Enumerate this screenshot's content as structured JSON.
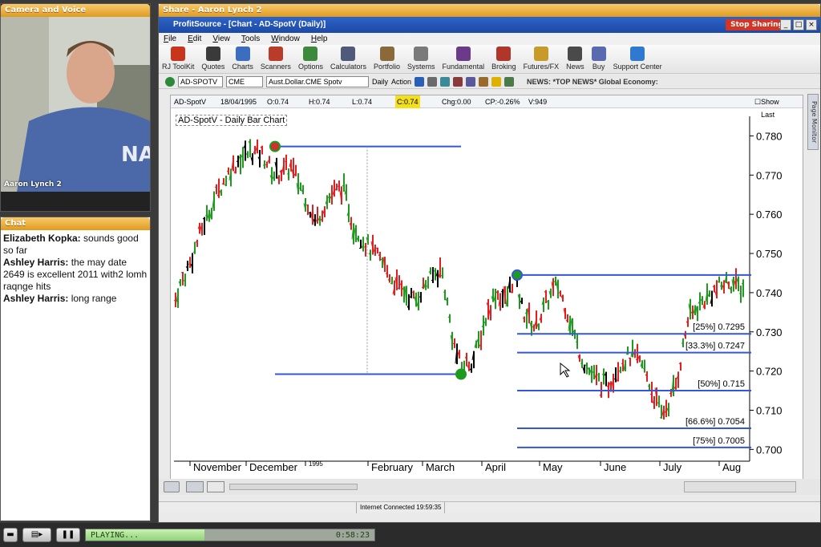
{
  "camera_panel": {
    "title": "Camera and Voice",
    "presenter_name": "Aaron Lynch 2"
  },
  "chat_panel": {
    "title": "Chat",
    "messages": [
      {
        "author": "Elizabeth Kopka:",
        "text": " sounds good so far"
      },
      {
        "author": "Ashley Harris:",
        "text": " the may date 2649 is excellent 2011 with2 lomh raqnge hits"
      },
      {
        "author": "Ashley Harris:",
        "text": " long range"
      }
    ]
  },
  "share_panel": {
    "title": "Share - Aaron Lynch 2",
    "stop_sharing_label": "Stop Sharing"
  },
  "app": {
    "window_title": "ProfitSource - [Chart - AD-SpotV (Daily)]",
    "menu": [
      "File",
      "Edit",
      "View",
      "Tools",
      "Window",
      "Help"
    ],
    "toolbar": [
      {
        "label": "RJ ToolKit",
        "icon": "toolkit-icon",
        "color": "#c8341c"
      },
      {
        "label": "Quotes",
        "icon": "quotes-icon",
        "color": "#3a3a3a"
      },
      {
        "label": "Charts",
        "icon": "charts-icon",
        "color": "#3d6dbf"
      },
      {
        "label": "Scanners",
        "icon": "scanners-icon",
        "color": "#b93b2a"
      },
      {
        "label": "Options",
        "icon": "options-icon",
        "color": "#3d8a3d"
      },
      {
        "label": "Calculators",
        "icon": "calculators-icon",
        "color": "#4f5a7a"
      },
      {
        "label": "Portfolio",
        "icon": "portfolio-icon",
        "color": "#8a6a3a"
      },
      {
        "label": "Systems",
        "icon": "systems-icon",
        "color": "#7a7a7a"
      },
      {
        "label": "Fundamental",
        "icon": "fundamental-icon",
        "color": "#6b3b8a"
      },
      {
        "label": "Broking",
        "icon": "broking-icon",
        "color": "#b0352a"
      },
      {
        "label": "Futures/FX",
        "icon": "futures-icon",
        "color": "#c89a2a"
      },
      {
        "label": "News",
        "icon": "news-icon",
        "color": "#4a4a4a"
      },
      {
        "label": "Buy",
        "icon": "buy-icon",
        "color": "#5a6ab0"
      },
      {
        "label": "Support Center",
        "icon": "support-icon",
        "color": "#2f7ad0"
      }
    ],
    "symbol_field": "AD-SPOTV",
    "exchange_field": "CME",
    "description_field": "Aust.Dollar.CME Spotv",
    "period_label": "Daily",
    "action_label": "Action",
    "news_ticker": "NEWS: *TOP NEWS* Global Economy:",
    "page_monitor_label": "Page Monitor",
    "status_connection": "Internet Connected 19:59:35"
  },
  "quote": {
    "symbol": "AD-SpotV",
    "date": "18/04/1995",
    "open": "O:0.74",
    "high": "H:0.74",
    "low": "L:0.74",
    "close": "C:0.74",
    "change": "Chg:0.00",
    "change_pct": "CP:-0.26%",
    "volume": "V:949",
    "show_last_label": "Show Last"
  },
  "chart_title": "AD-SpotV - Daily Bar Chart",
  "chart_data": {
    "type": "bar",
    "title": "AD-SpotV - Daily Bar Chart",
    "ylim": [
      0.697,
      0.785
    ],
    "y_ticks": [
      "0.780",
      "0.770",
      "0.760",
      "0.750",
      "0.740",
      "0.730",
      "0.720",
      "0.710",
      "0.700"
    ],
    "x_labels": [
      "November",
      "December",
      "1995",
      "February",
      "March",
      "April",
      "May",
      "June",
      "July",
      "Aug"
    ],
    "horizontal_lines": [
      {
        "y": 0.7773,
        "from": "December",
        "to": "March"
      },
      {
        "y": 0.7192,
        "from": "November",
        "to": "March"
      }
    ],
    "fib_levels": [
      {
        "label": "",
        "value": 0.7445
      },
      {
        "label": "[25%] 0.7295",
        "value": 0.7295
      },
      {
        "label": "[33.3%] 0.7247",
        "value": 0.7247
      },
      {
        "label": "[50%] 0.715",
        "value": 0.715
      },
      {
        "label": "[66.6%] 0.7054",
        "value": 0.7054
      },
      {
        "label": "[75%] 0.7005",
        "value": 0.7005
      }
    ],
    "up_color": "#1e9a1e",
    "down_color": "#e02020",
    "neutral_color": "#000000",
    "fib_color": "#3456d8",
    "grid": false
  },
  "player": {
    "status": "PLAYING...",
    "time": "0:58:23",
    "progress": 0.41
  }
}
